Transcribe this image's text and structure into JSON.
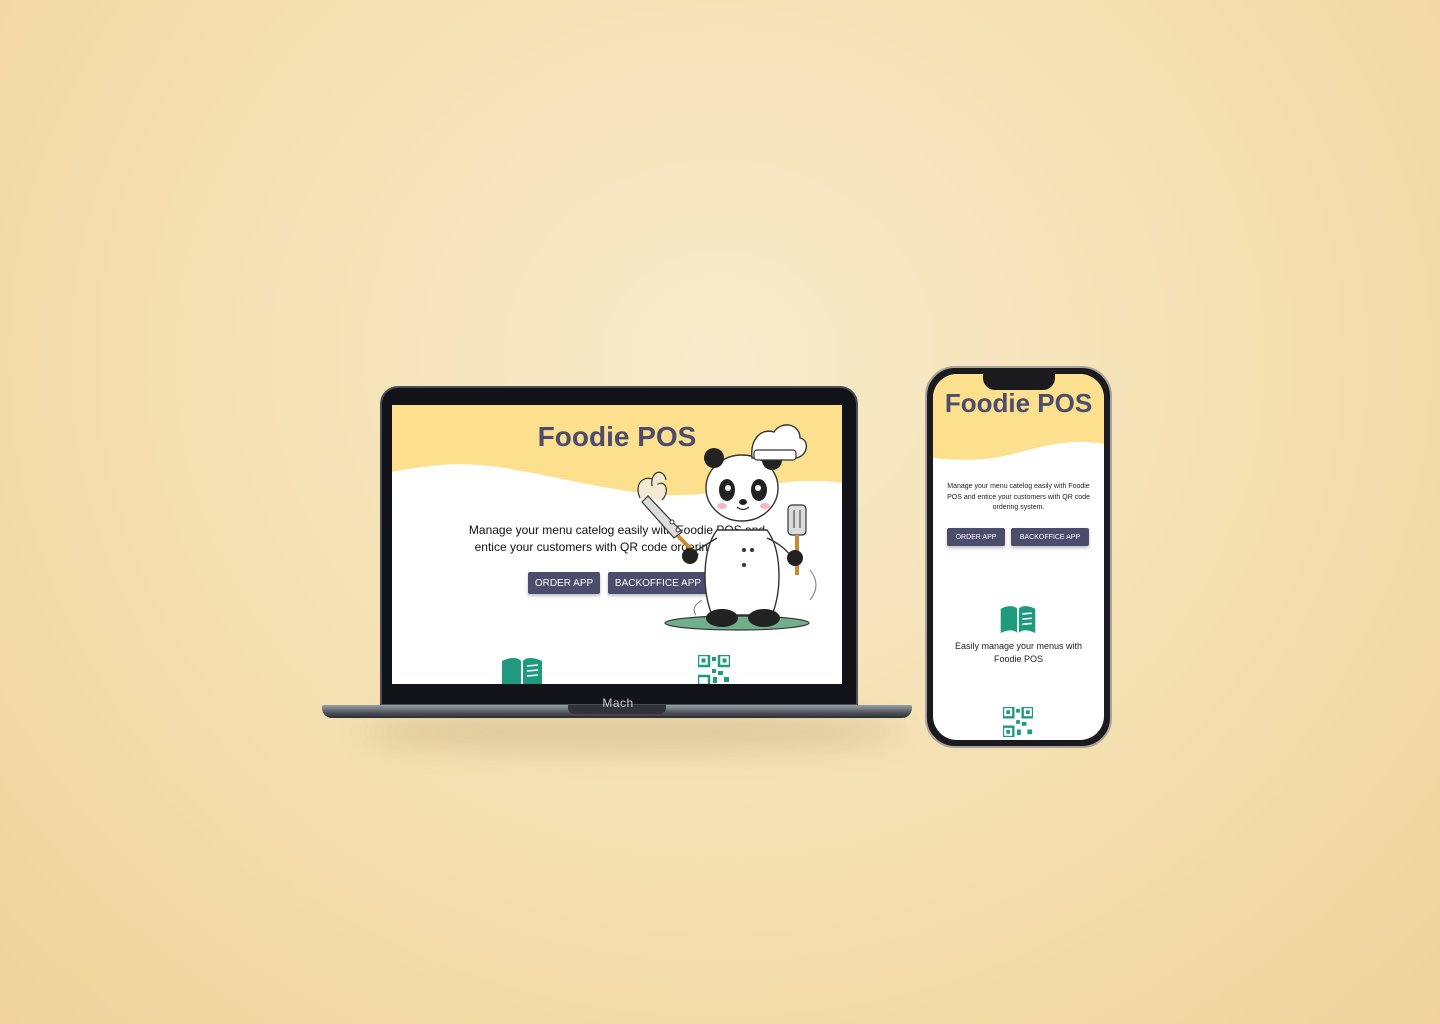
{
  "colors": {
    "accent": "#4c4c6d",
    "header_band": "#fde08e",
    "icon_green": "#1f9a7e"
  },
  "laptop": {
    "brand": "Mach",
    "site": {
      "title": "Foodie POS",
      "description": "Manage your menu catelog easily with Foodie POS and entice your customers with QR code ordering system.",
      "buttons": {
        "order": "ORDER APP",
        "backoffice": "BACKOFFICE APP"
      },
      "features": [
        {
          "icon": "menu-book-icon"
        },
        {
          "icon": "qr-code-icon"
        }
      ],
      "mascot": "panda-chef-illustration"
    }
  },
  "phone": {
    "site": {
      "title": "Foodie POS",
      "description": "Manage your menu catelog easily with Foodie POS and entice your customers with QR code ordering system.",
      "buttons": {
        "order": "ORDER APP",
        "backoffice": "BACKOFFICE APP"
      },
      "features": [
        {
          "icon": "menu-book-icon",
          "text": "Easily manage your menus with Foodie POS"
        },
        {
          "icon": "qr-code-icon"
        }
      ]
    }
  }
}
